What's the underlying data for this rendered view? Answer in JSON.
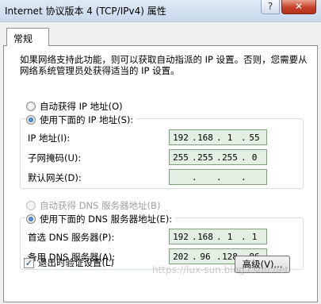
{
  "window": {
    "title": "Internet 协议版本 4 (TCP/IPv4) 属性",
    "help_glyph": "?",
    "close_glyph": "✕"
  },
  "tab": {
    "label": "常规"
  },
  "description": "如果网络支持此功能，则可以获取自动指派的 IP 设置。否则，您需要从网络系统管理员处获得适当的 IP 设置。",
  "ip_section": {
    "auto_label": "自动获得 IP 地址(O)",
    "manual_label": "使用下面的 IP 地址(S):",
    "auto_selected": false,
    "fields": [
      {
        "label": "IP 地址(I):",
        "octets": [
          "192",
          "168",
          "1",
          "55"
        ]
      },
      {
        "label": "子网掩码(U):",
        "octets": [
          "255",
          "255",
          "255",
          "0"
        ]
      },
      {
        "label": "默认网关(D):",
        "octets": [
          "",
          "",
          "",
          ""
        ]
      }
    ]
  },
  "dns_section": {
    "auto_label": "自动获得 DNS 服务器地址(B)",
    "manual_label": "使用下面的 DNS 服务器地址(E):",
    "auto_enabled": false,
    "fields": [
      {
        "label": "首选 DNS 服务器(P):",
        "octets": [
          "192",
          "168",
          "1",
          "1"
        ]
      },
      {
        "label": "备用 DNS 服务器(A):",
        "octets": [
          "202",
          "96",
          "128",
          "86"
        ]
      }
    ]
  },
  "validate": {
    "label": "退出时验证设置(L)",
    "checked": true,
    "check_glyph": "✓"
  },
  "advanced_button": "高级(V)...",
  "watermark": "https://lux-sun.blog.csdn.net"
}
